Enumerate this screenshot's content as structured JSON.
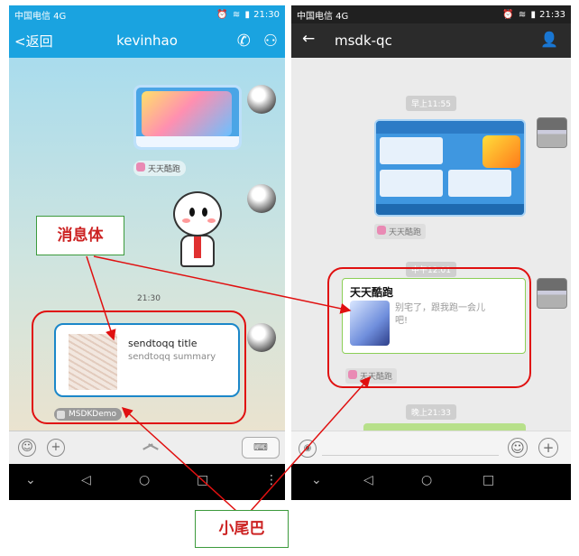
{
  "left_phone": {
    "status_bar": {
      "carrier": "中国电信 4G",
      "time": "21:30",
      "icons": "⏰ ≋ ▮"
    },
    "title_bar": {
      "back_label": "<返回",
      "title": "kevinhao",
      "call_icon": "phone-icon",
      "profile_icon": "person-icon"
    },
    "messages": {
      "game_card_tag": "天天酷跑",
      "timestamp": "21:30",
      "share_title": "sendtoqq title",
      "share_summary": "sendtoqq summary",
      "share_tag": "MSDKDemo"
    },
    "input_bar": {
      "emoji_icon": "smiley-icon",
      "plus_icon": "plus-icon",
      "keyboard_icon": "keyboard-icon"
    }
  },
  "right_phone": {
    "status_bar": {
      "carrier": "中国电信 4G",
      "time": "21:33",
      "icons": "⏰ ≋ ▮"
    },
    "title_bar": {
      "back_icon": "arrow-left-icon",
      "title": "msdk-qc",
      "user_icon": "person-icon"
    },
    "messages": {
      "time_morning": "早上11:55",
      "game_card_tag": "天天酷跑",
      "time_noon": "中午12:01",
      "card_title": "天天酷跑",
      "card_desc": "别宅了，跟我跑一会儿吧!",
      "card_tag": "天天酷跑",
      "time_night": "晚上21:33"
    },
    "input_bar": {
      "voice_icon": "voice-icon",
      "emoji_icon": "smiley-icon",
      "plus_icon": "plus-icon"
    }
  },
  "annotations": {
    "message_body_label": "消息体",
    "tail_label": "小尾巴",
    "highlight_color": "#e01010",
    "label_border_color": "#3c9a3c"
  }
}
